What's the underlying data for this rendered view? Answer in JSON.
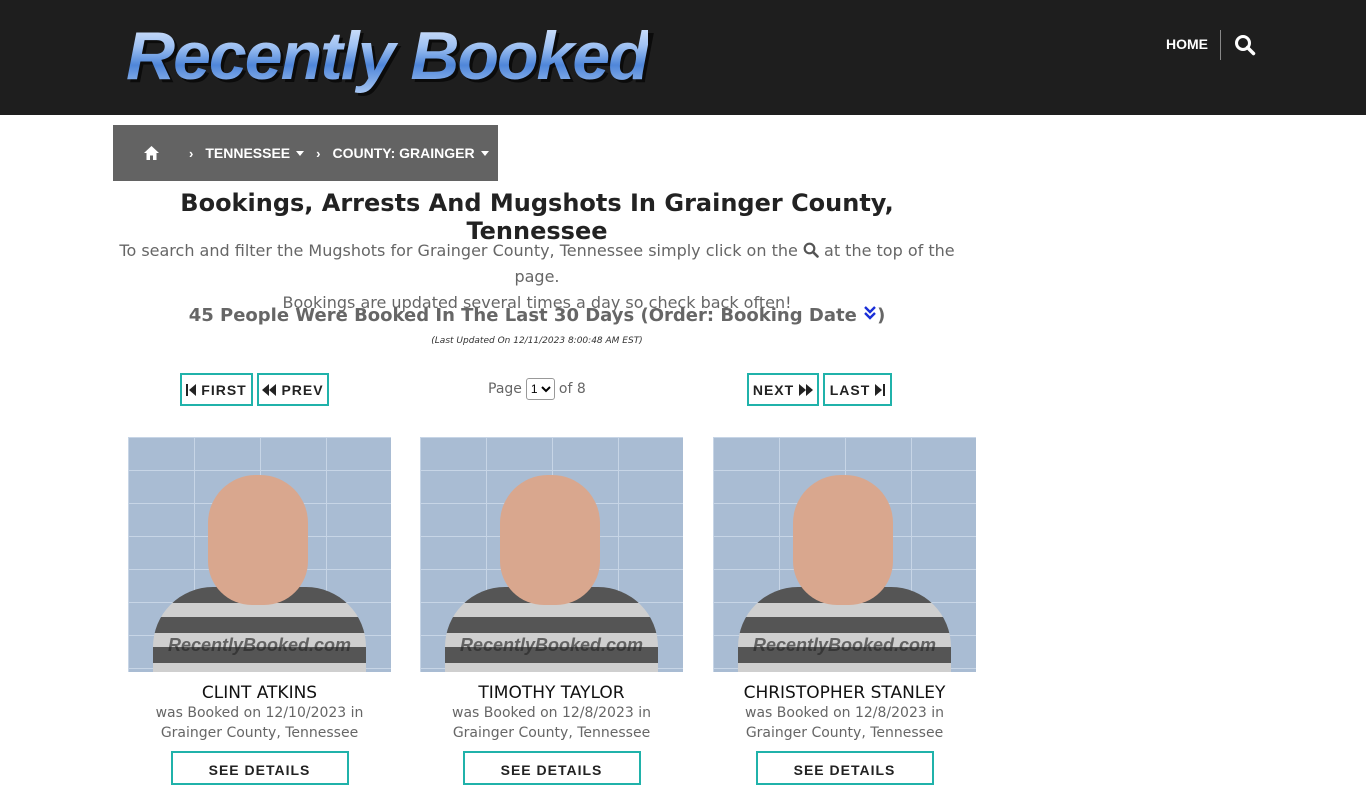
{
  "header": {
    "logo_text": "Recently Booked",
    "nav_home": "HOME",
    "search_icon": "search-icon"
  },
  "breadcrumb": {
    "home_icon": "home-icon",
    "state": "TENNESSEE",
    "county": "COUNTY: GRAINGER"
  },
  "main": {
    "title": "Bookings, Arrests And Mugshots In Grainger County, Tennessee",
    "desc_before_icon": "To search and filter the Mugshots for Grainger County, Tennessee simply click on the",
    "desc_after_icon": "at the top of the page.",
    "desc_line2": "Bookings are updated several times a day so check back often!",
    "count_text": "45 People Were Booked In The Last 30 Days (Order: Booking Date",
    "count_close": ")",
    "updated": "(Last Updated On 12/11/2023 8:00:48 AM EST)"
  },
  "pagination": {
    "first": "FIRST",
    "prev": "PREV",
    "next": "NEXT",
    "last": "LAST",
    "page_label": "Page",
    "current_page": "1",
    "of_label": "of 8"
  },
  "cards": [
    {
      "name": "CLINT ATKINS",
      "booked_line": "was Booked on 12/10/2023 in",
      "location": "Grainger County, Tennessee",
      "details": "SEE DETAILS",
      "watermark": "RecentlyBooked.com"
    },
    {
      "name": "TIMOTHY TAYLOR",
      "booked_line": "was Booked on 12/8/2023 in",
      "location": "Grainger County, Tennessee",
      "details": "SEE DETAILS",
      "watermark": "RecentlyBooked.com"
    },
    {
      "name": "CHRISTOPHER STANLEY",
      "booked_line": "was Booked on 12/8/2023 in",
      "location": "Grainger County, Tennessee",
      "details": "SEE DETAILS",
      "watermark": "RecentlyBooked.com"
    }
  ],
  "colors": {
    "header_bg": "#1e1e1e",
    "breadcrumb_bg": "#636363",
    "accent_border": "#20b2aa",
    "sort_icon": "#1a2fd8"
  }
}
